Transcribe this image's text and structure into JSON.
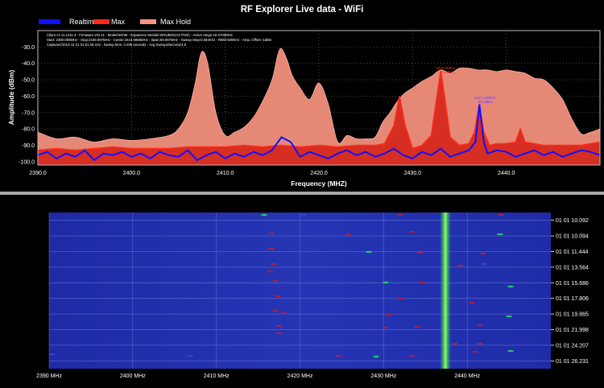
{
  "window": {
    "title": "RF Explorer Live data - WiFi"
  },
  "legend": [
    {
      "label": "Realtime",
      "color": "#1010ff"
    },
    {
      "label": "Max",
      "color": "#ff2a1a"
    },
    {
      "label": "Max Hold",
      "color": "#f89480"
    }
  ],
  "info_lines": [
    "Client v1.11.1211.4 - Firmware v01.11 - Model:6G0M - Expansion Module:WSUB3G(ACTIVE) - Active range:15-2700MHz",
    "Start: 2390.000MHz - Stop:2449.997MHz - Center:2419.9985MHz - Span:59.997MHz - Sweep Step:0.584Khz - RBW:600KHz - Amp. Offset:-1dBm",
    "Captured:2013-11-21 01:51:26.415 - Sweep time: 0.209 seconds - Avg Sweeps/second:4.8"
  ],
  "markers": [
    {
      "label": "2433.0MHz",
      "value": "-44.5dBm",
      "color": "#ff2a1a"
    },
    {
      "label": "2437.14MHZ",
      "value": "-65.2dBm",
      "color": "#5a2dff"
    }
  ],
  "chart_data": {
    "type": "area",
    "title": "RF Explorer Live data - WiFi",
    "xlabel": "Frequency (MHZ)",
    "ylabel": "Amplitude (dBm)",
    "xlim": [
      2390,
      2449.997
    ],
    "ylim": [
      -102,
      -20
    ],
    "x_ticks": [
      "2390.0",
      "2400.0",
      "2410.0",
      "2420.0",
      "2430.0",
      "2440.0"
    ],
    "y_ticks": [
      "-30.0",
      "-40.0",
      "-50.0",
      "-60.0",
      "-70.0",
      "-80.0",
      "-90.0",
      "-100.0"
    ],
    "grid": true,
    "legend_position": "top-left",
    "series": [
      {
        "name": "Max Hold",
        "x": [
          2390,
          2392,
          2394,
          2396,
          2398,
          2400,
          2402,
          2404,
          2405,
          2406,
          2406.8,
          2407.3,
          2407.7,
          2408.2,
          2409,
          2410,
          2411,
          2412,
          2413,
          2414,
          2415,
          2415.6,
          2416,
          2416.6,
          2417.2,
          2418,
          2419,
          2420,
          2421,
          2422,
          2423,
          2424,
          2425,
          2426,
          2426.8,
          2427.6,
          2428.4,
          2429.2,
          2430,
          2431,
          2432,
          2433,
          2434,
          2435,
          2436,
          2437,
          2438,
          2439,
          2440,
          2441,
          2442,
          2443,
          2444,
          2445,
          2446,
          2447,
          2448,
          2449,
          2449.997
        ],
        "y": [
          -82,
          -86,
          -85,
          -88,
          -86,
          -87,
          -86,
          -84,
          -80,
          -70,
          -52,
          -36,
          -33,
          -42,
          -70,
          -84,
          -82,
          -79,
          -73,
          -63,
          -50,
          -35,
          -31,
          -38,
          -48,
          -55,
          -62,
          -52,
          -65,
          -88,
          -84,
          -86,
          -86,
          -85,
          -76,
          -70,
          -63,
          -58,
          -55,
          -51,
          -48,
          -44,
          -46,
          -43,
          -43,
          -44,
          -44,
          -45,
          -44,
          -45,
          -46,
          -49,
          -50,
          -55,
          -62,
          -74,
          -83,
          -82,
          -80
        ]
      },
      {
        "name": "Max",
        "x": [
          2390,
          2392,
          2394,
          2396,
          2398,
          2400,
          2402,
          2404,
          2406,
          2408,
          2410,
          2412,
          2414,
          2416,
          2418,
          2420,
          2422,
          2424,
          2426,
          2427,
          2428,
          2428.6,
          2429.2,
          2430,
          2431,
          2432,
          2432.6,
          2433,
          2433.4,
          2434,
          2435,
          2436,
          2436.6,
          2437.1,
          2437.6,
          2438.2,
          2439,
          2440,
          2441,
          2441.5,
          2442,
          2443,
          2444,
          2446,
          2448,
          2449.997
        ],
        "y": [
          -93,
          -92,
          -93,
          -92,
          -91,
          -92,
          -92,
          -92,
          -91,
          -91,
          -91,
          -90,
          -91,
          -90,
          -91,
          -90,
          -91,
          -90,
          -90,
          -89,
          -78,
          -60,
          -78,
          -92,
          -90,
          -84,
          -60,
          -44.5,
          -60,
          -85,
          -90,
          -89,
          -82,
          -65.2,
          -82,
          -90,
          -89,
          -89,
          -88,
          -80,
          -88,
          -89,
          -90,
          -90,
          -90,
          -88
        ]
      },
      {
        "name": "Realtime",
        "x": [
          2390,
          2391,
          2392,
          2393,
          2394,
          2395,
          2396,
          2397,
          2398,
          2399,
          2400,
          2401,
          2402,
          2403,
          2404,
          2405,
          2406,
          2407,
          2408,
          2409,
          2410,
          2411,
          2412,
          2413,
          2414,
          2415,
          2416,
          2417,
          2418,
          2419,
          2420,
          2421,
          2422,
          2423,
          2424,
          2425,
          2426,
          2427,
          2428,
          2429,
          2430,
          2431,
          2432,
          2433,
          2434,
          2435,
          2436,
          2436.7,
          2437.14,
          2437.6,
          2438,
          2439,
          2440,
          2441,
          2442,
          2443,
          2444,
          2445,
          2446,
          2447,
          2448,
          2449,
          2449.997
        ],
        "y": [
          -96,
          -94,
          -98,
          -95,
          -97,
          -93,
          -99,
          -95,
          -96,
          -94,
          -97,
          -95,
          -98,
          -94,
          -96,
          -97,
          -93,
          -99,
          -96,
          -94,
          -98,
          -95,
          -97,
          -94,
          -96,
          -93,
          -85,
          -88,
          -97,
          -94,
          -96,
          -98,
          -95,
          -93,
          -96,
          -94,
          -97,
          -95,
          -92,
          -96,
          -98,
          -94,
          -96,
          -92,
          -97,
          -95,
          -93,
          -88,
          -65.2,
          -88,
          -95,
          -93,
          -94,
          -97,
          -95,
          -93,
          -96,
          -94,
          -97,
          -95,
          -93,
          -94,
          -96
        ]
      }
    ]
  },
  "waterfall": {
    "x_ticks": [
      "2390 MHz",
      "2400 MHz",
      "2410 MHz",
      "2420 MHz",
      "2430 MHz",
      "2440 MHz"
    ],
    "time_labels": [
      "01 01 10.092",
      "01 01 10.094",
      "01 01 11.444",
      "01 01 13.564",
      "01 01 15.686",
      "01 01 17.806",
      "01 01 19.865",
      "01 01 21.998",
      "01 01 24.207",
      "01 01 26.231"
    ]
  }
}
